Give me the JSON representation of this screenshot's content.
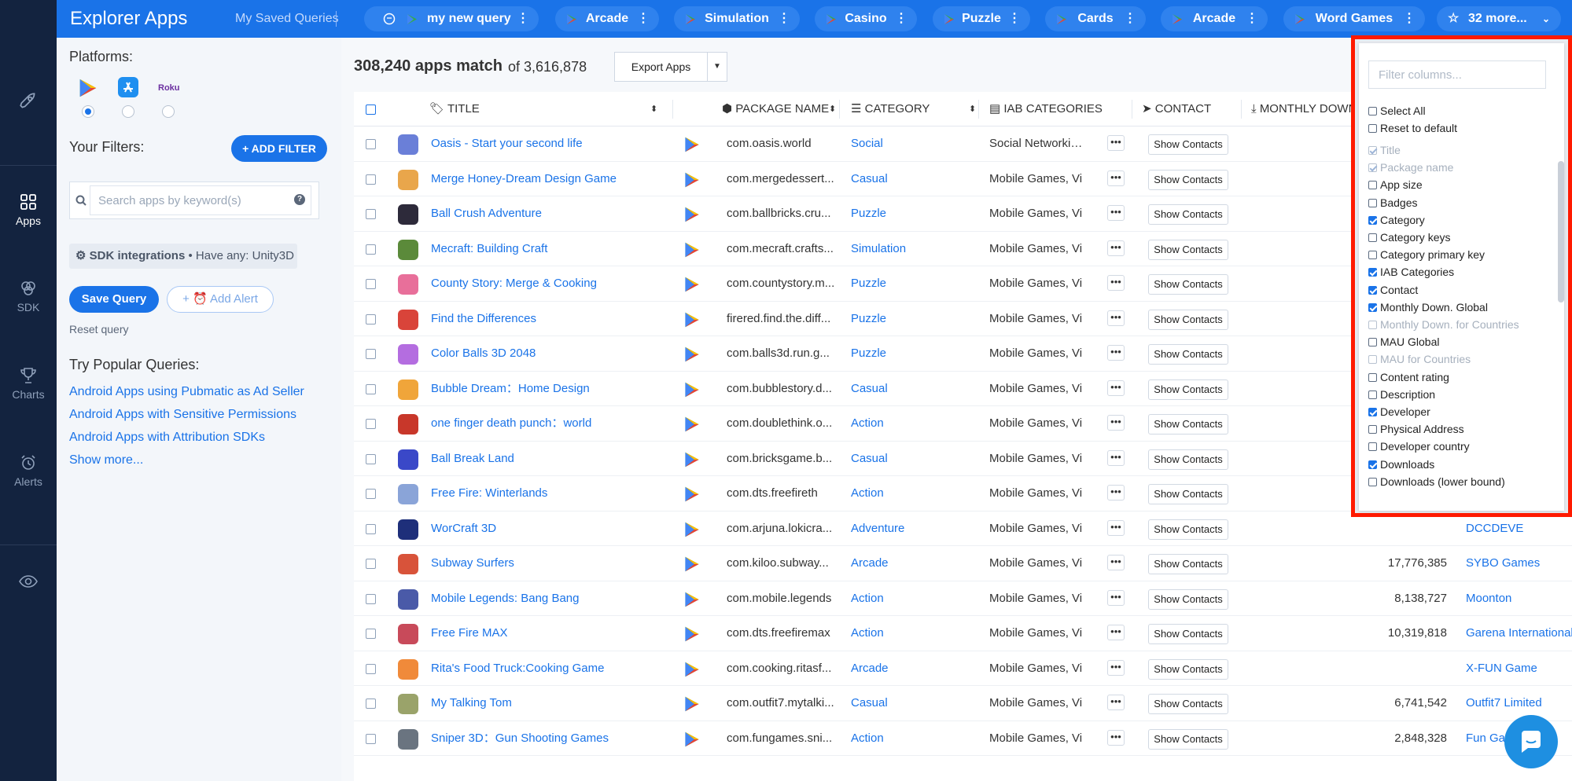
{
  "rail": {
    "items": [
      {
        "label": "",
        "icon": "rocket-icon"
      },
      {
        "label": "Apps",
        "icon": "apps-grid-icon"
      },
      {
        "label": "SDK",
        "icon": "sdk-layers-icon"
      },
      {
        "label": "Charts",
        "icon": "trophy-icon"
      },
      {
        "label": "Alerts",
        "icon": "alert-bell-icon"
      },
      {
        "label": "",
        "icon": "eye-icon"
      }
    ]
  },
  "topbar": {
    "title": "Explorer Apps",
    "saved_queries": "My Saved Queries",
    "tabs": [
      {
        "label": "my new query",
        "icon": "android-icon"
      },
      {
        "label": "Arcade",
        "icon": "google-play-icon"
      },
      {
        "label": "Simulation",
        "icon": "google-play-icon"
      },
      {
        "label": "Casino",
        "icon": "google-play-icon"
      },
      {
        "label": "Puzzle",
        "icon": "google-play-icon"
      },
      {
        "label": "Cards",
        "icon": "google-play-icon"
      },
      {
        "label": "Arcade",
        "icon": "google-play-icon"
      },
      {
        "label": "Word Games",
        "icon": "google-play-icon"
      }
    ],
    "more_label": "32 more...",
    "menu_glyph": "⋮"
  },
  "filters": {
    "platforms_label": "Platforms:",
    "platforms": [
      {
        "name": "Google Play",
        "selected": true
      },
      {
        "name": "App Store",
        "selected": false
      },
      {
        "name": "Roku",
        "selected": false,
        "logo_text": "Roku"
      }
    ],
    "your_filters_label": "Your Filters:",
    "add_filter_label": "+ ADD FILTER",
    "search_placeholder": "Search apps by keyword(s)",
    "help_glyph": "?",
    "sdk_chip_title": "SDK integrations",
    "sdk_chip_value": "• Have any: Unity3D",
    "save_query_label": "Save Query",
    "add_alert_label": "Add Alert",
    "reset_query_label": "Reset query",
    "popular_title": "Try Popular Queries:",
    "popular_queries": [
      "Android Apps using Pubmatic as Ad Seller",
      "Android Apps with Sensitive Permissions",
      "Android Apps with Attribution SDKs",
      "Show more..."
    ]
  },
  "results": {
    "count": "308,240 apps match",
    "of_total": "of 3,616,878",
    "export_label": "Export Apps"
  },
  "table": {
    "headers": {
      "title": "TITLE",
      "package": "PACKAGE NAME",
      "category": "CATEGORY",
      "iab": "IAB CATEGORIES",
      "contact": "CONTACT",
      "monthly": "MONTHLY DOWN"
    },
    "show_contacts_label": "Show Contacts",
    "more_glyph": "•••",
    "rows": [
      {
        "title": "Oasis - Start your second life",
        "package": "com.oasis.world",
        "category": "Social",
        "iab": "Social Networking",
        "downloads": "",
        "developer": "",
        "icon_color": "#6a7fd8"
      },
      {
        "title": "Merge Honey-Dream Design Game",
        "package": "com.mergedessert...",
        "category": "Casual",
        "iab": "Mobile Games, Vi",
        "downloads": "",
        "developer": "",
        "icon_color": "#e9a64b"
      },
      {
        "title": "Ball Crush Adventure",
        "package": "com.ballbricks.cru...",
        "category": "Puzzle",
        "iab": "Mobile Games, Vi",
        "downloads": "",
        "developer": "",
        "icon_color": "#2d2a3a"
      },
      {
        "title": "Mecraft: Building Craft",
        "package": "com.mecraft.crafts...",
        "category": "Simulation",
        "iab": "Mobile Games, Vi",
        "downloads": "",
        "developer": "",
        "icon_color": "#5b8a3a"
      },
      {
        "title": "County Story: Merge & Cooking",
        "package": "com.countystory.m...",
        "category": "Puzzle",
        "iab": "Mobile Games, Vi",
        "downloads": "",
        "developer": "",
        "icon_color": "#e86f9a"
      },
      {
        "title": "Find the Differences",
        "package": "firered.find.the.diff...",
        "category": "Puzzle",
        "iab": "Mobile Games, Vi",
        "downloads": "",
        "developer": "",
        "icon_color": "#d9443a"
      },
      {
        "title": "Color Balls 3D 2048",
        "package": "com.balls3d.run.g...",
        "category": "Puzzle",
        "iab": "Mobile Games, Vi",
        "downloads": "",
        "developer": "",
        "icon_color": "#b46de0"
      },
      {
        "title": "Bubble Dream：Home Design",
        "package": "com.bubblestory.d...",
        "category": "Casual",
        "iab": "Mobile Games, Vi",
        "downloads": "",
        "developer": "",
        "icon_color": "#f0a53a"
      },
      {
        "title": "one finger death punch：world",
        "package": "com.doublethink.o...",
        "category": "Action",
        "iab": "Mobile Games, Vi",
        "downloads": "",
        "developer": "",
        "icon_color": "#c8372a"
      },
      {
        "title": "Ball Break Land",
        "package": "com.bricksgame.b...",
        "category": "Casual",
        "iab": "Mobile Games, Vi",
        "downloads": "",
        "developer": "",
        "icon_color": "#3a48c8"
      },
      {
        "title": "Free Fire: Winterlands",
        "package": "com.dts.freefireth",
        "category": "Action",
        "iab": "Mobile Games, Vi",
        "downloads": "",
        "developer": "",
        "icon_color": "#8aa4d8"
      },
      {
        "title": "WorCraft 3D",
        "package": "com.arjuna.lokicra...",
        "category": "Adventure",
        "iab": "Mobile Games, Vi",
        "downloads": "",
        "developer": "DCCDEVE",
        "icon_color": "#1e2f7a"
      },
      {
        "title": "Subway Surfers",
        "package": "com.kiloo.subway...",
        "category": "Arcade",
        "iab": "Mobile Games, Vi",
        "downloads": "17,776,385",
        "developer": "SYBO Games",
        "icon_color": "#d8533a"
      },
      {
        "title": "Mobile Legends: Bang Bang",
        "package": "com.mobile.legends",
        "category": "Action",
        "iab": "Mobile Games, Vi",
        "downloads": "8,138,727",
        "developer": "Moonton",
        "icon_color": "#4a5aa8"
      },
      {
        "title": "Free Fire MAX",
        "package": "com.dts.freefiremax",
        "category": "Action",
        "iab": "Mobile Games, Vi",
        "downloads": "10,319,818",
        "developer": "Garena International",
        "icon_color": "#c84a5a"
      },
      {
        "title": "Rita's Food Truck:Cooking Game",
        "package": "com.cooking.ritasf...",
        "category": "Arcade",
        "iab": "Mobile Games, Vi",
        "downloads": "",
        "developer": "X-FUN Game",
        "icon_color": "#f08a3a"
      },
      {
        "title": "My Talking Tom",
        "package": "com.outfit7.mytalki...",
        "category": "Casual",
        "iab": "Mobile Games, Vi",
        "downloads": "6,741,542",
        "developer": "Outfit7 Limited",
        "icon_color": "#9aa36a"
      },
      {
        "title": "Sniper 3D：Gun Shooting Games",
        "package": "com.fungames.sni...",
        "category": "Action",
        "iab": "Mobile Games, Vi",
        "downloads": "2,848,328",
        "developer": "Fun Games",
        "icon_color": "#6a7480"
      }
    ]
  },
  "columns_menu": {
    "filter_placeholder": "Filter columns...",
    "select_all": "Select All",
    "reset_default": "Reset to default",
    "options": [
      {
        "label": "Title",
        "checked": true,
        "disabled": true
      },
      {
        "label": "Package name",
        "checked": true,
        "disabled": true
      },
      {
        "label": "App size",
        "checked": false,
        "disabled": false
      },
      {
        "label": "Badges",
        "checked": false,
        "disabled": false
      },
      {
        "label": "Category",
        "checked": true,
        "disabled": false
      },
      {
        "label": "Category keys",
        "checked": false,
        "disabled": false
      },
      {
        "label": "Category primary key",
        "checked": false,
        "disabled": false
      },
      {
        "label": "IAB Categories",
        "checked": true,
        "disabled": false
      },
      {
        "label": "Contact",
        "checked": true,
        "disabled": false
      },
      {
        "label": "Monthly Down. Global",
        "checked": true,
        "disabled": false
      },
      {
        "label": "Monthly Down. for Countries",
        "checked": false,
        "disabled": true
      },
      {
        "label": "MAU Global",
        "checked": false,
        "disabled": false
      },
      {
        "label": "MAU for Countries",
        "checked": false,
        "disabled": true
      },
      {
        "label": "Content rating",
        "checked": false,
        "disabled": false
      },
      {
        "label": "Description",
        "checked": false,
        "disabled": false
      },
      {
        "label": "Developer",
        "checked": true,
        "disabled": false
      },
      {
        "label": "Physical Address",
        "checked": false,
        "disabled": false
      },
      {
        "label": "Developer country",
        "checked": false,
        "disabled": false
      },
      {
        "label": "Downloads",
        "checked": true,
        "disabled": false
      },
      {
        "label": "Downloads (lower bound)",
        "checked": false,
        "disabled": false
      }
    ]
  },
  "colors": {
    "brand_blue": "#1a73e8",
    "rail_navy": "#13233f",
    "highlight_red": "#ff1a00"
  }
}
